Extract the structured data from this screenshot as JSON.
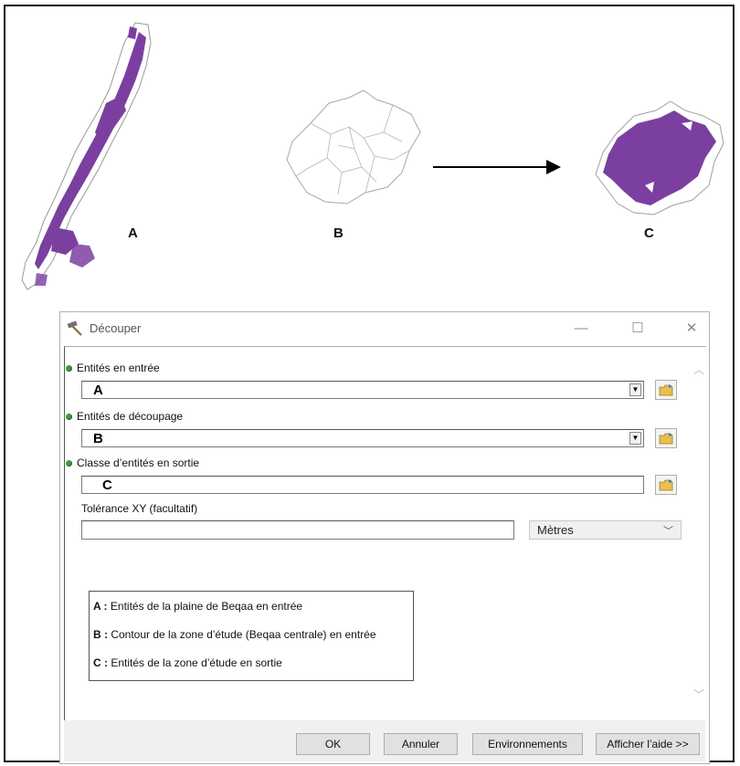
{
  "figure": {
    "map_labels": [
      "A",
      "B",
      "C"
    ],
    "colors": {
      "feature": "#7b3fa0",
      "outline": "#999999"
    }
  },
  "dialog": {
    "title": "Découper",
    "title_icon": "hammer-icon",
    "window_buttons": [
      "—",
      "☐",
      "✕"
    ],
    "fields": {
      "input_label": "Entités en entrée",
      "input_value": "A",
      "clip_label": "Entités de découpage",
      "clip_value": "B",
      "output_label": "Classe d’entités en sortie",
      "output_value": "C",
      "tolerance_label": "Tolérance XY (facultatif)",
      "tolerance_value": "",
      "units_value": "Mètres"
    },
    "legend": [
      {
        "key": "A :",
        "text": " Entités de la plaine de Beqaa en entrée"
      },
      {
        "key": "B :",
        "text": " Contour de la zone d’étude (Beqaa centrale) en entrée"
      },
      {
        "key": "C :",
        "text": " Entités de la zone d’étude en sortie"
      }
    ],
    "buttons": {
      "ok": "OK",
      "cancel": "Annuler",
      "environments": "Environnements",
      "help": "Afficher l’aide >>"
    }
  }
}
